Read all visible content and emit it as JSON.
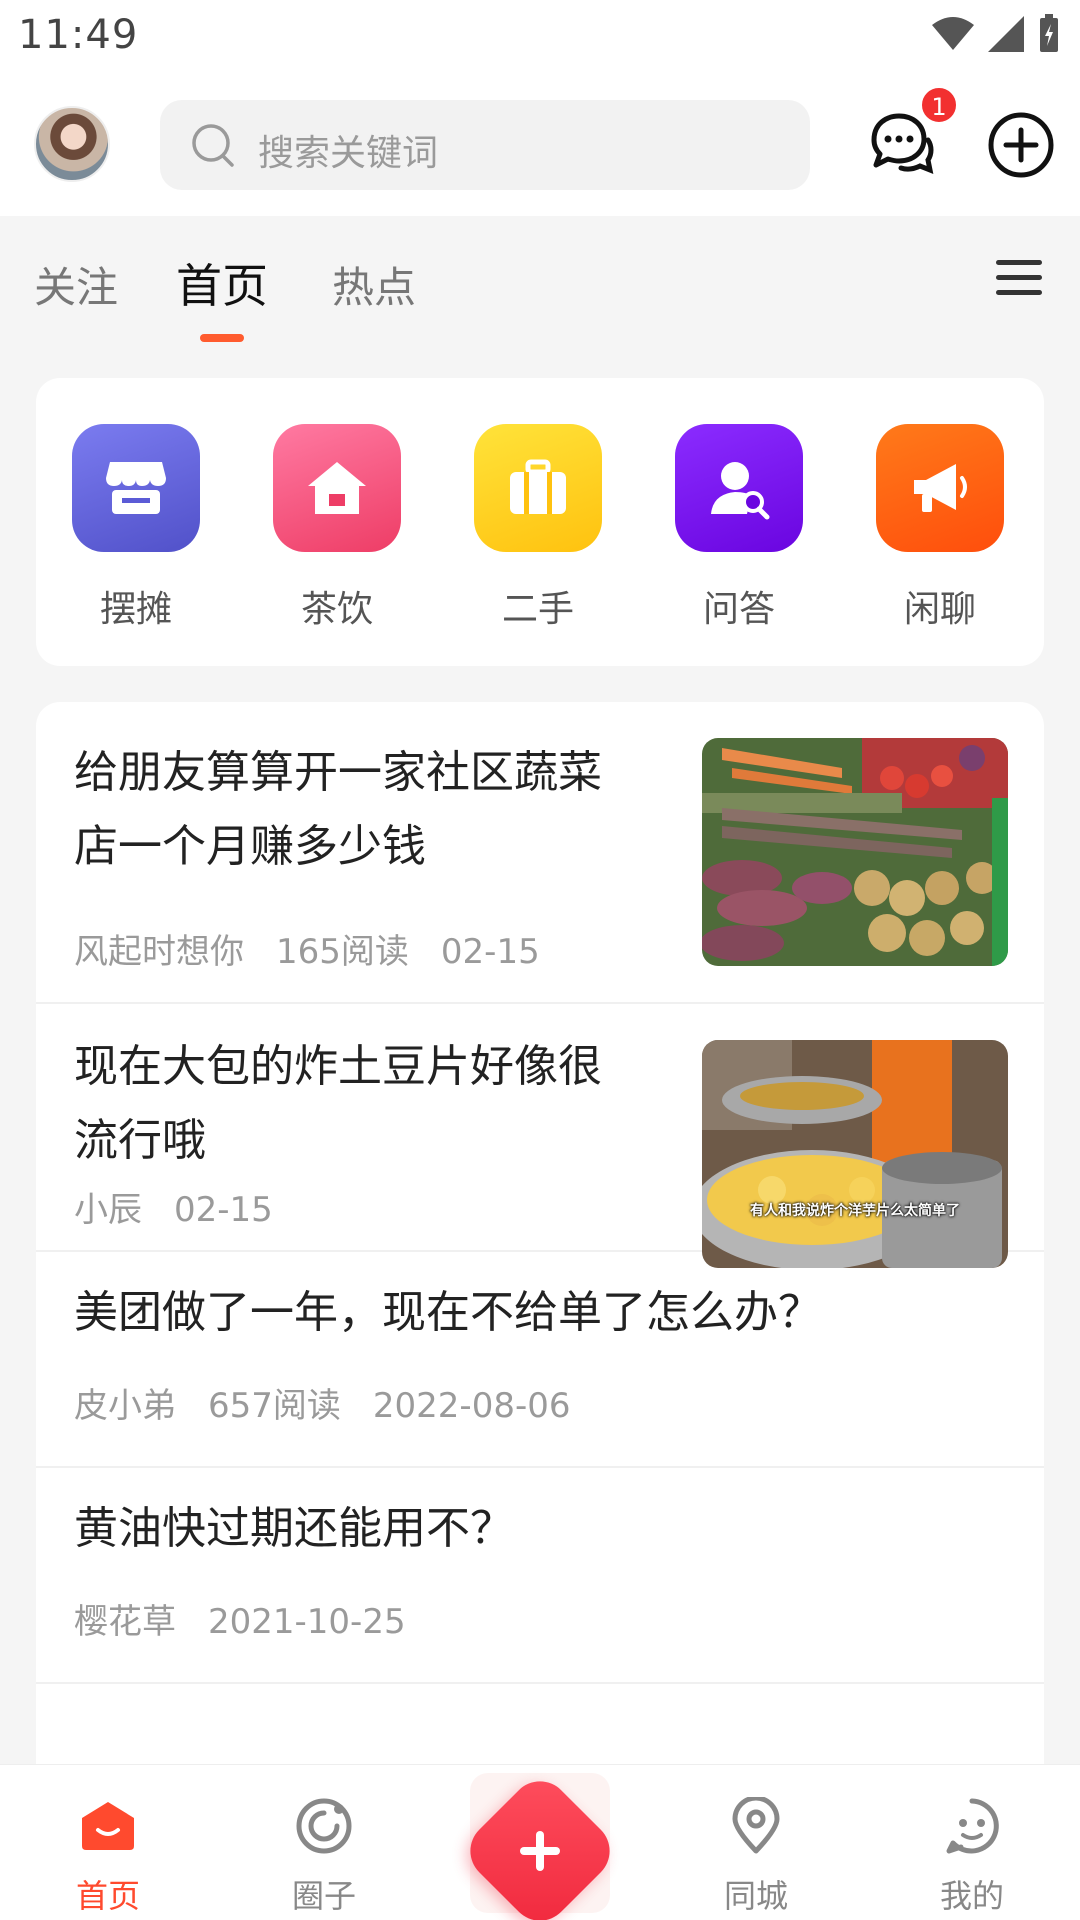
{
  "status_bar": {
    "time": "11:49"
  },
  "header": {
    "search_placeholder": "搜索关键词",
    "message_badge": "1"
  },
  "tabs": [
    {
      "label": "关注"
    },
    {
      "label": "首页"
    },
    {
      "label": "热点"
    }
  ],
  "categories": [
    {
      "label": "摆摊",
      "icon": "stall-icon",
      "color": "#5b5bd6"
    },
    {
      "label": "茶饮",
      "icon": "house-icon",
      "color": "#f2507a"
    },
    {
      "label": "二手",
      "icon": "suitcase-icon",
      "color": "#ffcf1a"
    },
    {
      "label": "问答",
      "icon": "person-search-icon",
      "color": "#7a14f0"
    },
    {
      "label": "闲聊",
      "icon": "megaphone-icon",
      "color": "#ff5a14"
    }
  ],
  "posts": [
    {
      "title_line1": "给朋友算算开一家社区蔬菜",
      "title_line2": "店一个月赚多少钱",
      "author": "风起时想你",
      "reads": "165阅读",
      "date": "02-15"
    },
    {
      "title_line1": "现在大包的炸土豆片好像很",
      "title_line2": "流行哦",
      "author": "小辰",
      "date": "02-15",
      "image_caption": "有人和我说炸个洋芋片么太简单了"
    },
    {
      "title": "美团做了一年，现在不给单了怎么办？",
      "author": "皮小弟",
      "reads": "657阅读",
      "date": "2022-08-06"
    },
    {
      "title": "黄油快过期还能用不？",
      "author": "樱花草",
      "date": "2021-10-25"
    }
  ],
  "bottom_nav": [
    {
      "label": "首页"
    },
    {
      "label": "圈子"
    },
    {
      "label": "同城"
    },
    {
      "label": "我的"
    }
  ],
  "colors": {
    "accent": "#ff4a2e",
    "publish": "#f0283d"
  }
}
